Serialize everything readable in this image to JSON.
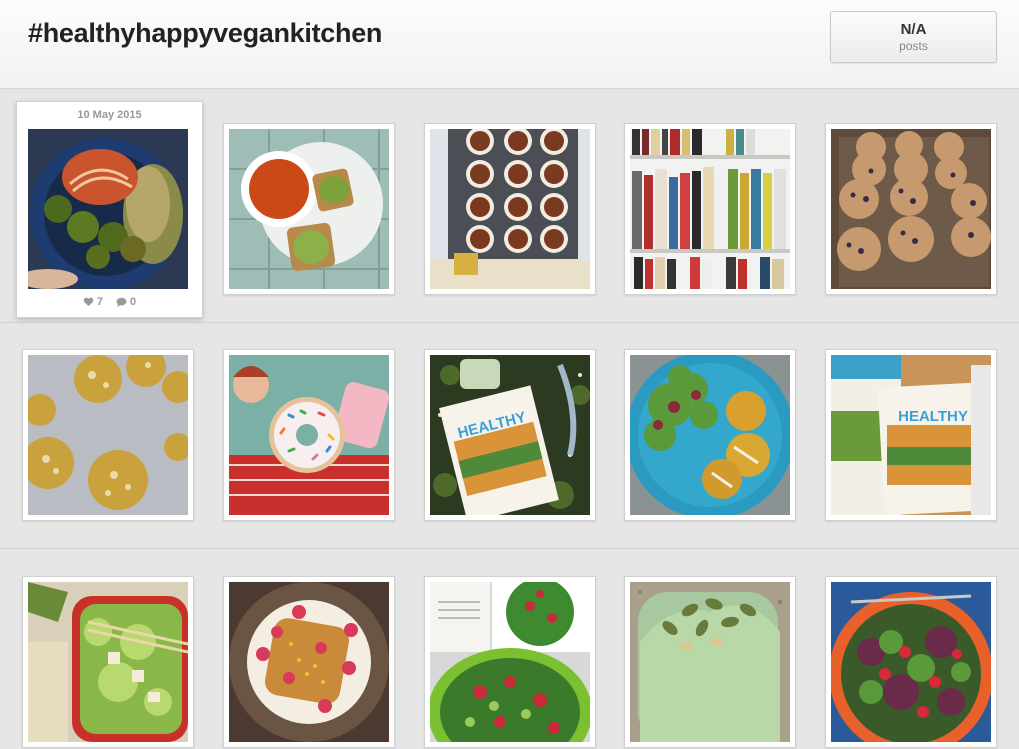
{
  "header": {
    "title": "#healthyhappyvegankitchen",
    "posts_count": "N/A",
    "posts_label": "posts"
  },
  "featured": {
    "date": "10 May 2015",
    "likes": "7",
    "comments": "0"
  },
  "photos": [
    {
      "id": "1",
      "subject": "veggie-burger-broccoli-sprouts"
    },
    {
      "id": "2",
      "subject": "tomato-soup-avocado-toast"
    },
    {
      "id": "3",
      "subject": "cupcake-tin"
    },
    {
      "id": "4",
      "subject": "bookshelf"
    },
    {
      "id": "5",
      "subject": "blueberry-muffins"
    },
    {
      "id": "6",
      "subject": "oat-cookies"
    },
    {
      "id": "7",
      "subject": "sprinkle-donut"
    },
    {
      "id": "8",
      "subject": "cookbook-on-grass"
    },
    {
      "id": "9",
      "subject": "salad-and-patties"
    },
    {
      "id": "10",
      "subject": "cookbooks-on-table"
    },
    {
      "id": "11",
      "subject": "salad-bowl-chopsticks"
    },
    {
      "id": "12",
      "subject": "french-toast-raspberries"
    },
    {
      "id": "13",
      "subject": "strawberry-spinach-salad"
    },
    {
      "id": "14",
      "subject": "green-smoothie-pumpkin-seeds"
    },
    {
      "id": "15",
      "subject": "mixed-greens-strawberries"
    }
  ]
}
